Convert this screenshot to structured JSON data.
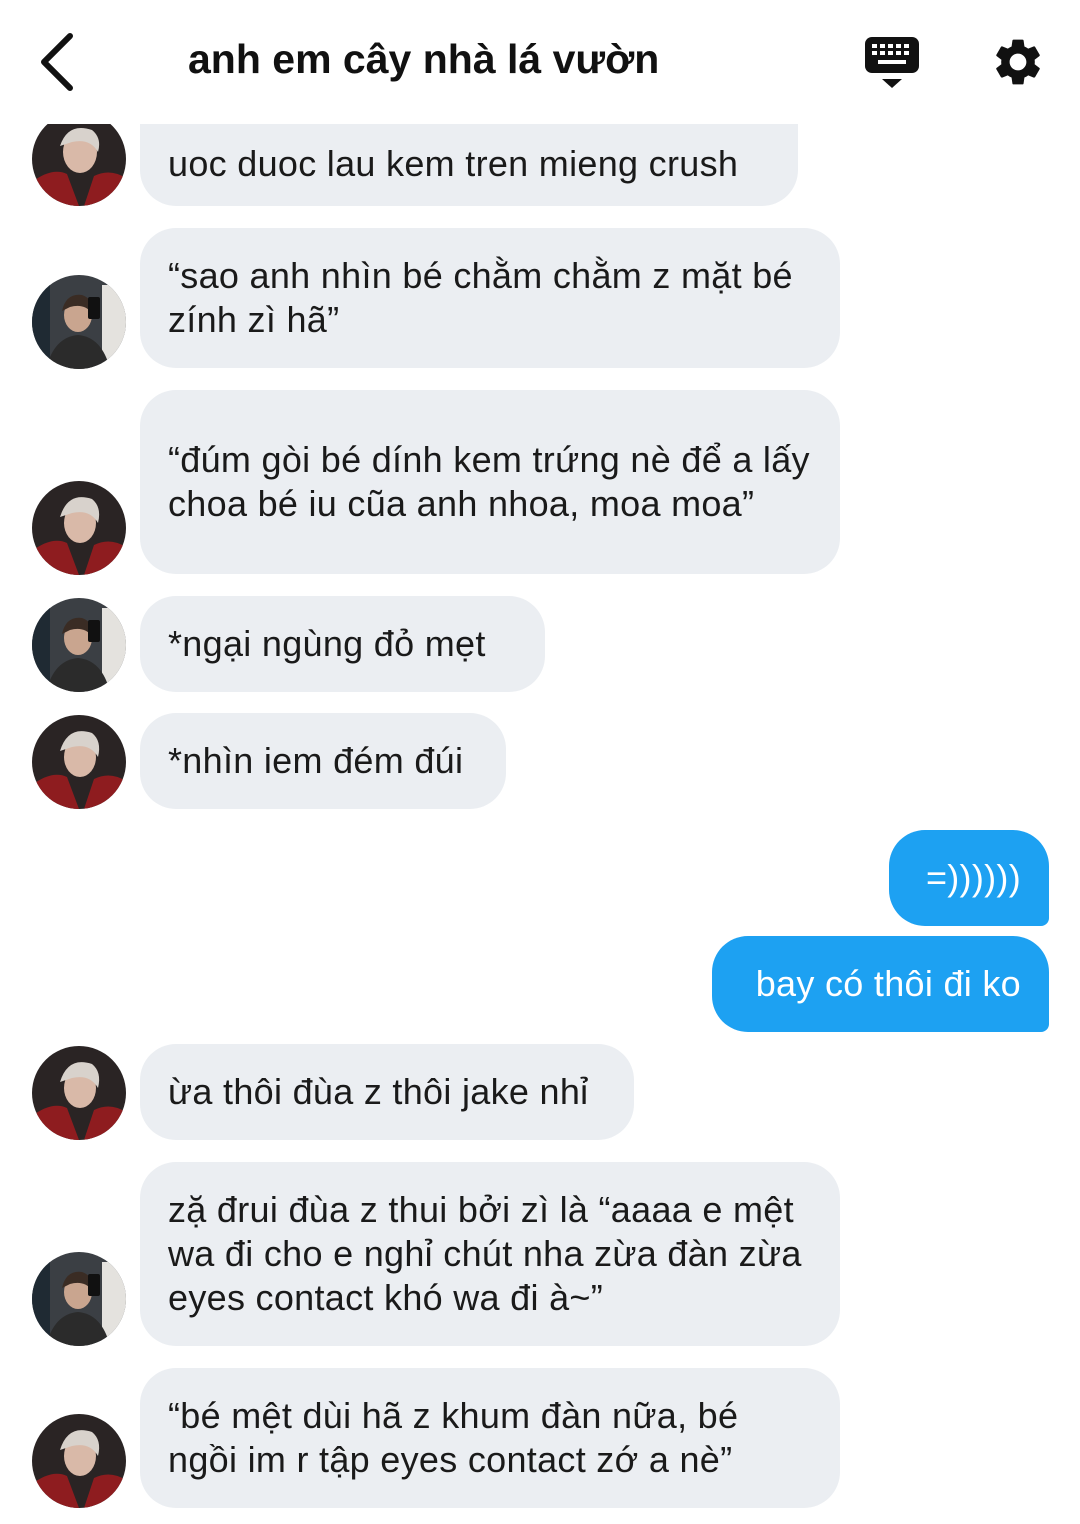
{
  "header": {
    "title": "anh em cây nhà lá vườn",
    "back_icon": "chevron-left-icon",
    "keyboard_icon": "keyboard-icon",
    "settings_icon": "gear-icon"
  },
  "colors": {
    "incoming_bubble": "#ebeef2",
    "outgoing_bubble": "#1da1f2",
    "outgoing_text": "#ffffff"
  },
  "messages": [
    {
      "side": "in",
      "avatar": "avatar-red-jacket",
      "text": "uoc duoc lau kem tren mieng crush"
    },
    {
      "side": "in",
      "avatar": "avatar-mirror-selfie",
      "text": "“sao anh nhìn bé chằm chằm z mặt bé zính zì hã”"
    },
    {
      "side": "in",
      "avatar": "avatar-red-jacket",
      "text": "“đúm gòi bé dính kem trứng nè để a lấy choa bé iu cũa anh nhoa, moa moa”"
    },
    {
      "side": "in",
      "avatar": "avatar-mirror-selfie",
      "text": "*ngại ngùng đỏ mẹt"
    },
    {
      "side": "in",
      "avatar": "avatar-red-jacket",
      "text": "*nhìn iem đém đúi"
    },
    {
      "side": "out",
      "text": "=))))))"
    },
    {
      "side": "out",
      "text": "bay có thôi đi ko"
    },
    {
      "side": "in",
      "avatar": "avatar-red-jacket",
      "text": "ừa thôi đùa z thôi jake nhỉ"
    },
    {
      "side": "in",
      "avatar": "avatar-mirror-selfie",
      "text": "zặ đrui đùa z thui bởi zì là “aaaa e mệt wa đi cho e nghỉ chút nha zừa đàn zừa eyes contact khó wa đi à~”"
    },
    {
      "side": "in",
      "avatar": "avatar-red-jacket",
      "text": "“bé mệt dùi hã z khum đàn nữa, bé ngồi im r tập eyes contact zớ a nè”"
    }
  ]
}
